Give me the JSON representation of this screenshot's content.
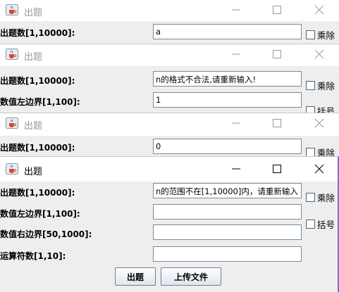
{
  "windows": [
    {
      "title": "出题",
      "fields": [
        {
          "label": "出题数[1,10000]:",
          "value": "a"
        }
      ],
      "checkboxes": [
        {
          "label": "乘除"
        }
      ]
    },
    {
      "title": "出题",
      "fields": [
        {
          "label": "出题数[1,10000]:",
          "value": "n的格式不合法,请重新输入!"
        },
        {
          "label": "数值左边界[1,100]:",
          "value": "1"
        }
      ],
      "checkboxes": [
        {
          "label": "乘除"
        },
        {
          "label": "括号"
        }
      ]
    },
    {
      "title": "出题",
      "fields": [
        {
          "label": "出题数[1,10000]:",
          "value": "0"
        }
      ],
      "checkboxes": [
        {
          "label": "乘除"
        }
      ]
    },
    {
      "title": "出题",
      "fields": [
        {
          "label": "出题数[1,10000]:",
          "value": "n的范围不在[1,10000]内，请重新输入"
        },
        {
          "label": "数值左边界[1,100]:",
          "value": ""
        },
        {
          "label": "数值右边界[50,1000]:",
          "value": ""
        },
        {
          "label": "运算符数[1,10]:",
          "value": ""
        }
      ],
      "checkboxes": [
        {
          "label": "乘除"
        },
        {
          "label": "括号"
        }
      ],
      "buttons": [
        {
          "label": "出题"
        },
        {
          "label": "上传文件"
        }
      ]
    }
  ],
  "icons": {
    "app": "java-cup-icon",
    "minimize": "minimize-icon",
    "maximize": "maximize-icon",
    "close": "close-icon"
  }
}
